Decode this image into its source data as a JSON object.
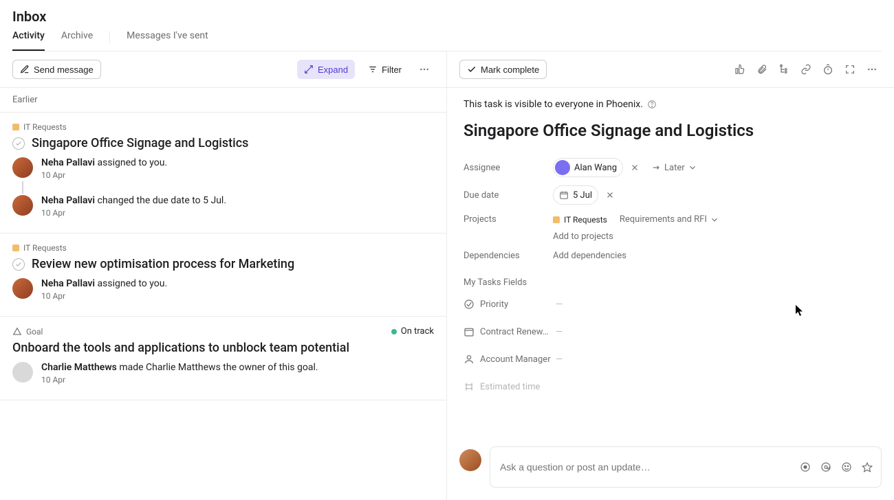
{
  "page_title": "Inbox",
  "tabs": {
    "activity": "Activity",
    "archive": "Archive",
    "sent": "Messages I've sent"
  },
  "toolbar": {
    "send_message": "Send message",
    "expand": "Expand",
    "filter": "Filter"
  },
  "sections": {
    "earlier": "Earlier"
  },
  "items": [
    {
      "type": "task",
      "project": "IT Requests",
      "title": "Singapore Office Signage and Logistics",
      "events": [
        {
          "who": "Neha Pallavi",
          "action": " assigned to you.",
          "ts": "10 Apr",
          "avatar": "np"
        },
        {
          "who": "Neha Pallavi",
          "action": " changed the due date to 5 Jul.",
          "ts": "10 Apr",
          "avatar": "np"
        }
      ]
    },
    {
      "type": "task",
      "project": "IT Requests",
      "title": "Review new optimisation process for Marketing",
      "events": [
        {
          "who": "Neha Pallavi",
          "action": " assigned to you.",
          "ts": "10 Apr",
          "avatar": "np"
        }
      ]
    },
    {
      "type": "goal",
      "goal_label": "Goal",
      "status": "On track",
      "title": "Onboard the tools and applications to unblock team potential",
      "events": [
        {
          "who": "Charlie Matthews",
          "action": " made Charlie Matthews the owner of this goal.",
          "ts": "10 Apr",
          "avatar": "cm"
        }
      ]
    }
  ],
  "detail": {
    "mark_complete": "Mark complete",
    "visibility": "This task is visible to everyone in Phoenix.",
    "title": "Singapore Office Signage and Logistics",
    "fields": {
      "assignee_label": "Assignee",
      "assignee_name": "Alan Wang",
      "later": "Later",
      "due_label": "Due date",
      "due_value": "5 Jul",
      "projects_label": "Projects",
      "project_name": "IT Requests",
      "project_section": "Requirements and RFI",
      "add_projects": "Add to projects",
      "deps_label": "Dependencies",
      "add_deps": "Add dependencies",
      "mtf_heading": "My Tasks Fields",
      "priority": "Priority",
      "contract": "Contract Renew…",
      "account_mgr": "Account Manager",
      "est_time": "Estimated time"
    },
    "composer_placeholder": "Ask a question or post an update…"
  }
}
